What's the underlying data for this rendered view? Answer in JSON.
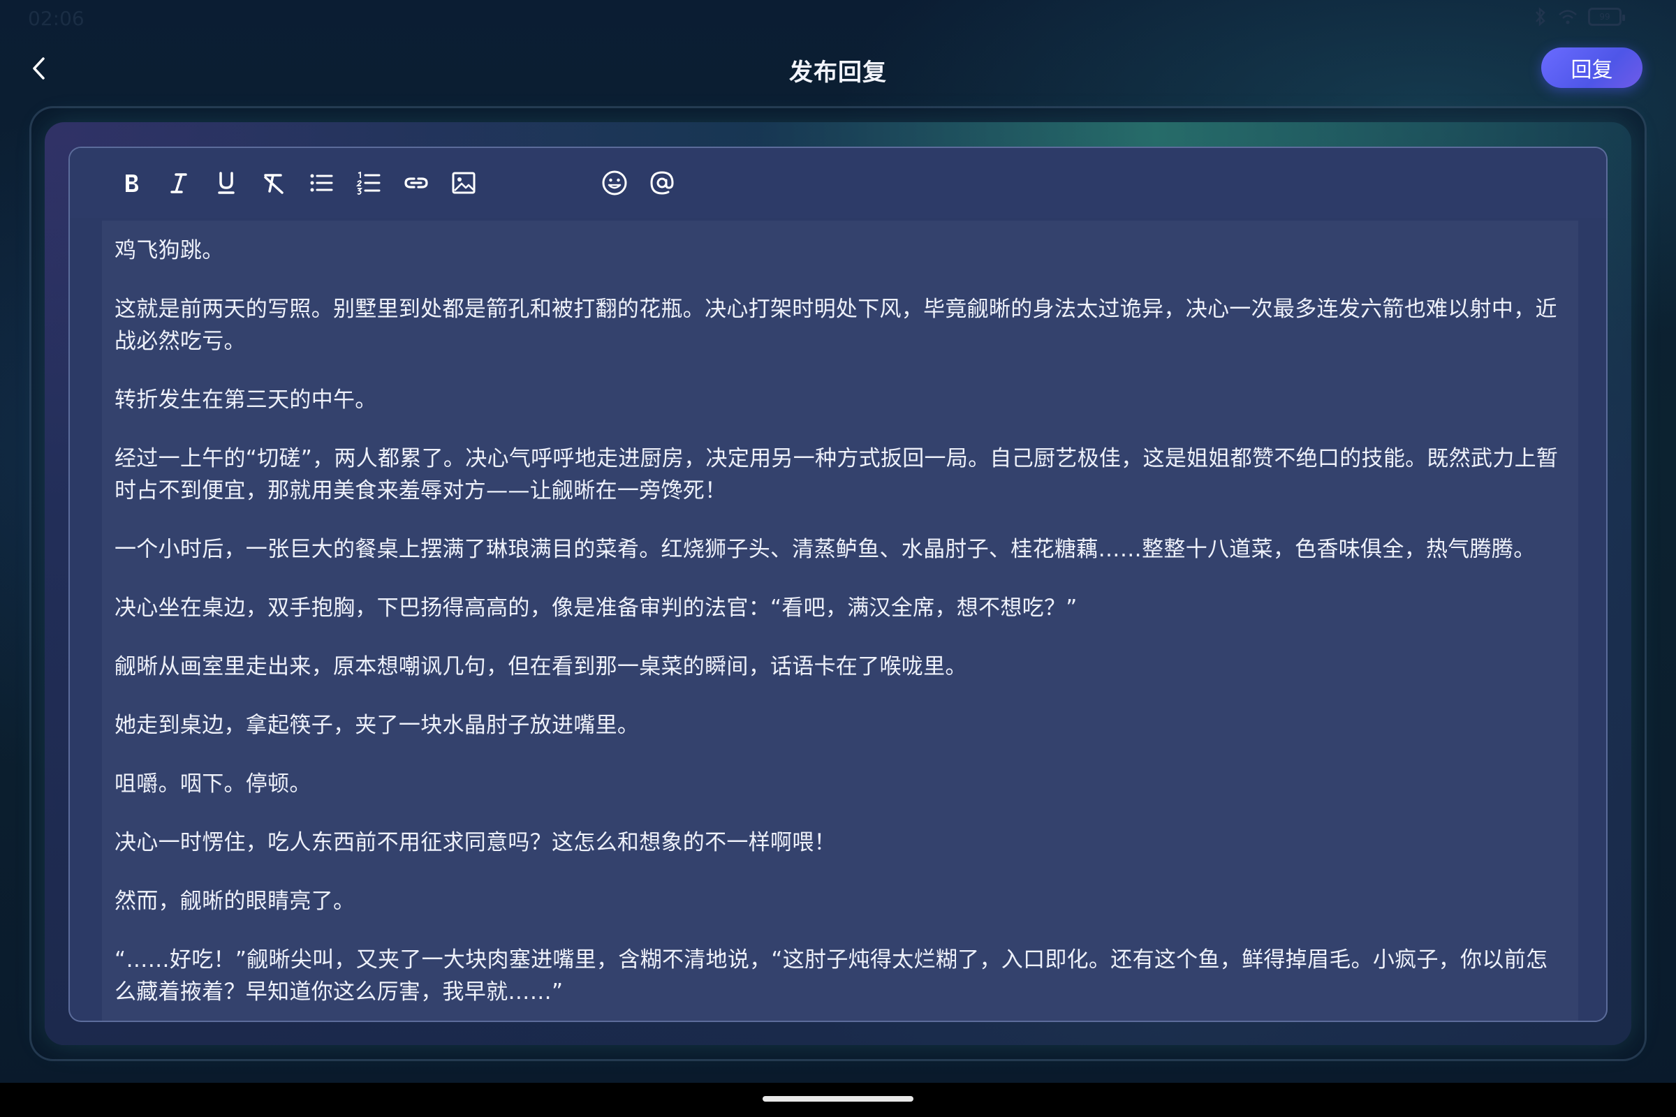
{
  "status_bar": {
    "time": "02:06",
    "battery": "99"
  },
  "header": {
    "title": "发布回复",
    "reply_label": "回复"
  },
  "toolbar": {
    "tools": [
      "bold-icon",
      "italic-icon",
      "underline-icon",
      "clear-format-icon",
      "bullet-list-icon",
      "ordered-list-icon",
      "link-icon",
      "image-icon",
      "emoji-icon",
      "mention-icon"
    ]
  },
  "content": {
    "paragraphs": [
      "鸡飞狗跳。",
      "这就是前两天的写照。别墅里到处都是箭孔和被打翻的花瓶。决心打架时明处下风，毕竟觎晰的身法太过诡异，决心一次最多连发六箭也难以射中，近战必然吃亏。",
      "转折发生在第三天的中午。",
      "经过一上午的“切磋”，两人都累了。决心气呼呼地走进厨房，决定用另一种方式扳回一局。自己厨艺极佳，这是姐姐都赞不绝口的技能。既然武力上暂时占不到便宜，那就用美食来羞辱对方——让觎晰在一旁馋死！",
      "一个小时后，一张巨大的餐桌上摆满了琳琅满目的菜肴。红烧狮子头、清蒸鲈鱼、水晶肘子、桂花糖藕……整整十八道菜，色香味俱全，热气腾腾。",
      "决心坐在桌边，双手抱胸，下巴扬得高高的，像是准备审判的法官：“看吧，满汉全席，想不想吃？”",
      "觎晰从画室里走出来，原本想嘲讽几句，但在看到那一桌菜的瞬间，话语卡在了喉咙里。",
      "她走到桌边，拿起筷子，夹了一块水晶肘子放进嘴里。",
      "咀嚼。咽下。停顿。",
      "决心一时愣住，吃人东西前不用征求同意吗？这怎么和想象的不一样啊喂！",
      "然而，觎晰的眼睛亮了。",
      "“……好吃！”觎晰尖叫，又夹了一大块肉塞进嘴里，含糊不清地说，“这肘子炖得太烂糊了，入口即化。还有这个鱼，鲜得掉眉毛。小疯子，你以前怎么藏着掖着？早知道你这么厉害，我早就……”"
    ]
  }
}
